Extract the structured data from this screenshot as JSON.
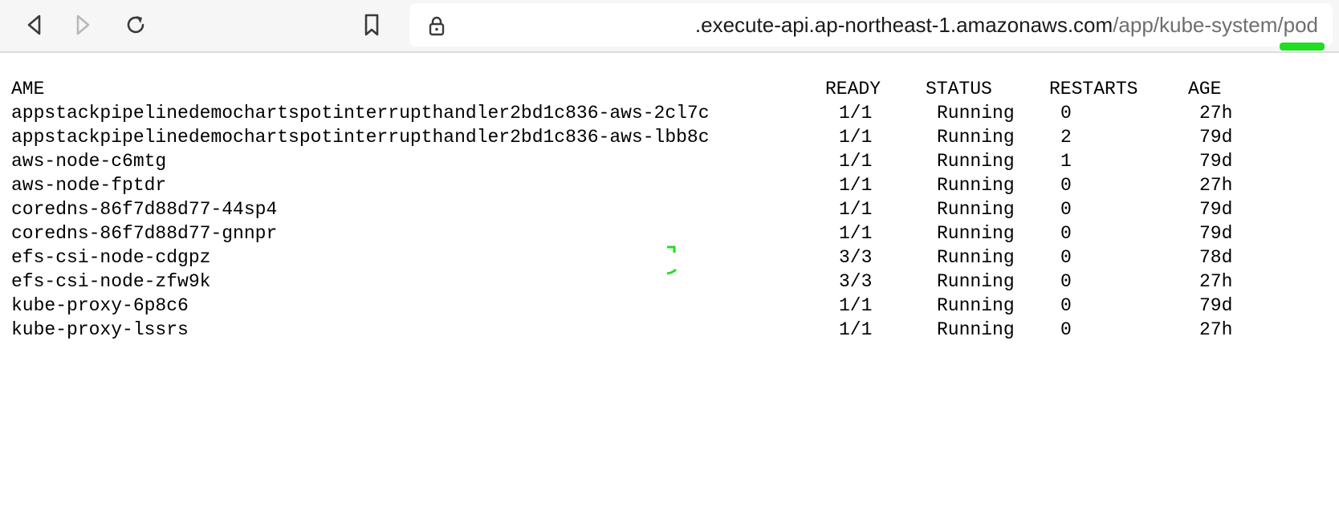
{
  "browser": {
    "back_icon": "chevron-left-icon",
    "forward_icon": "chevron-right-icon",
    "reload_icon": "reload-icon",
    "bookmark_icon": "bookmark-icon",
    "lock_icon": "lock-icon",
    "url_host": ".execute-api.ap-northeast-1.amazonaws.com",
    "url_path": "/app/kube-system/pod"
  },
  "colors": {
    "annotation_green": "#22dd22",
    "toolbar_bg": "#f6f6f6"
  },
  "table": {
    "headers": {
      "name": "AME",
      "ready": "READY",
      "status": "STATUS",
      "restarts": "RESTARTS",
      "age": "AGE"
    },
    "rows": [
      {
        "name": "appstackpipelinedemochartspotinterrupthandler2bd1c836-aws-2cl7c",
        "ready": "1/1",
        "status": "Running",
        "restarts": "0",
        "age": "27h"
      },
      {
        "name": "appstackpipelinedemochartspotinterrupthandler2bd1c836-aws-lbb8c",
        "ready": "1/1",
        "status": "Running",
        "restarts": "2",
        "age": "79d"
      },
      {
        "name": "aws-node-c6mtg",
        "ready": "1/1",
        "status": "Running",
        "restarts": "1",
        "age": "79d"
      },
      {
        "name": "aws-node-fptdr",
        "ready": "1/1",
        "status": "Running",
        "restarts": "0",
        "age": "27h"
      },
      {
        "name": "coredns-86f7d88d77-44sp4",
        "ready": "1/1",
        "status": "Running",
        "restarts": "0",
        "age": "79d"
      },
      {
        "name": "coredns-86f7d88d77-gnnpr",
        "ready": "1/1",
        "status": "Running",
        "restarts": "0",
        "age": "79d"
      },
      {
        "name": "efs-csi-node-cdgpz",
        "ready": "3/3",
        "status": "Running",
        "restarts": "0",
        "age": "78d"
      },
      {
        "name": "efs-csi-node-zfw9k",
        "ready": "3/3",
        "status": "Running",
        "restarts": "0",
        "age": "27h"
      },
      {
        "name": "kube-proxy-6p8c6",
        "ready": "1/1",
        "status": "Running",
        "restarts": "0",
        "age": "79d"
      },
      {
        "name": "kube-proxy-lssrs",
        "ready": "1/1",
        "status": "Running",
        "restarts": "0",
        "age": "27h"
      }
    ]
  }
}
